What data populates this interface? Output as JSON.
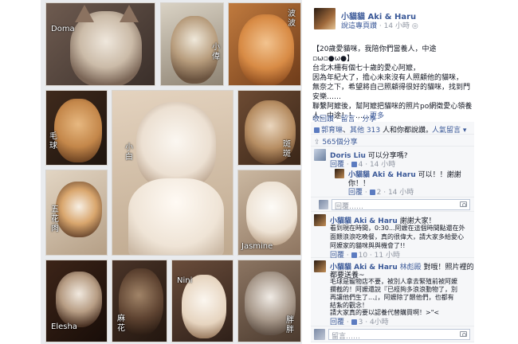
{
  "collage": {
    "captions": {
      "doma": "Doma",
      "xiaowei": "小偉",
      "bobo": "波波",
      "maoqiu": "毛球",
      "xiaobai": "小白",
      "banban": "斑斑",
      "wuhuarou": "五花肉",
      "jasmine": "Jasmine",
      "elesha": "Elesha",
      "mahua": "麻花",
      "nini": "Nini",
      "pangpang": "胖胖"
    }
  },
  "post": {
    "page_name": "小貓貓 Aki & Haru",
    "meta_action": "說這專頁讚",
    "meta_time": "14 小時",
    "body_lines": [
      "【20歲愛貓咪，我陪你們當養人，中途 ▫ω▫●ω●】",
      "台北木柵有個七十歲的愛心阿嬤，",
      "因為年紀大了，擔心未來沒有人照顧他的貓咪，",
      "無奈之下，希望將自己照顧得很好的貓咪，找到門",
      "安樂……",
      "聯繫阿嬤後，幫阿嬤把貓咪的照片po網徵愛心領養",
      "人、中途！！……"
    ],
    "more": "更多",
    "actions": [
      "收回讚",
      "留言",
      "分享"
    ],
    "likes_names": "郭育琳",
    "likes_rest_prefix": "其他",
    "likes_count": "313",
    "likes_suffix": "人和你都說讚。",
    "sort_label": "人氣留言",
    "shares": "565個分享"
  },
  "comments": [
    {
      "author": "Doris Liu",
      "text": "可以分享嗎?",
      "reply": "回覆",
      "likes": "4",
      "time": "14 小時"
    },
    {
      "author": "小貓貓 Aki & Haru",
      "text_lines": [
        "可以！！謝謝",
        "你！！"
      ],
      "reply": "回覆",
      "likes": "2",
      "time": "14 小時"
    },
    {
      "author": "小貓貓 Aki & Haru",
      "text_lines": [
        "謝謝大家！",
        "看到現在時間，0:30...阿嬤在這個時間點還在外",
        "面餵浪浪吃晚餐，真的很偉大，請大家多給愛心",
        "阿嬤家的貓咪與與機會了!!"
      ],
      "reply": "回覆",
      "likes": "10",
      "time": "11 小時"
    },
    {
      "author": "小貓貓 Aki & Haru",
      "tag": "林彪殿",
      "text_lines": [
        "對哦！照片裡的",
        "都要送養~",
        "毛球是寵物店不要，被別人拿去緊殖前被阿嬤",
        "攔截的！阿嬤還說『已經夠多浪浪動物了，別",
        "再讓他們生了...』，阿嬤除了餵他們，也都有",
        "結紮的觀念！",
        "請大家真的要以認養代替購買啊！>\"<"
      ],
      "reply": "回覆",
      "likes": "3",
      "time": "4小時"
    }
  ],
  "reply_placeholder": "回覆……",
  "comment_placeholder": "留言……",
  "colors": {
    "link": "#3b5998",
    "muted": "#9197a3",
    "comment_bg": "#f6f7f9"
  }
}
